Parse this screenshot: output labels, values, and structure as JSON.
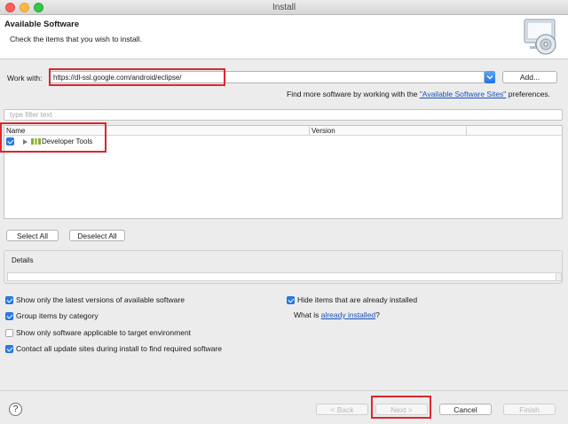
{
  "window": {
    "title": "Install"
  },
  "header": {
    "title": "Available Software",
    "description": "Check the items that you wish to install."
  },
  "work_with": {
    "label": "Work with:",
    "value": "https://dl-ssl.google.com/android/eclipse/",
    "add_label": "Add..."
  },
  "find_more": {
    "prefix": "Find more software by working with the",
    "link": "\"Available Software Sites\"",
    "suffix": "preferences."
  },
  "filter": {
    "placeholder": "type filter text"
  },
  "table": {
    "columns": [
      "Name",
      "Version"
    ],
    "rows": [
      {
        "checked": true,
        "name": "Developer Tools",
        "version": ""
      }
    ]
  },
  "selection_buttons": {
    "select_all": "Select All",
    "deselect_all": "Deselect All"
  },
  "details": {
    "title": "Details"
  },
  "options": [
    {
      "label": "Show only the latest versions of available software",
      "checked": true
    },
    {
      "label": "Group items by category",
      "checked": true
    },
    {
      "label": "Show only software applicable to target environment",
      "checked": false
    },
    {
      "label": "Contact all update sites during install to find required software",
      "checked": true
    }
  ],
  "right_options": {
    "hide_installed": {
      "label": "Hide items that are already installed",
      "checked": true
    },
    "what_is": {
      "prefix": "What is",
      "link": "already installed",
      "suffix": "?"
    }
  },
  "footer": {
    "help": "?",
    "back": "< Back",
    "next": "Next >",
    "cancel": "Cancel",
    "finish": "Finish"
  },
  "colors": {
    "accent": "#2b7ce9",
    "highlight": "#d9282e",
    "link": "#1a4fb5"
  }
}
